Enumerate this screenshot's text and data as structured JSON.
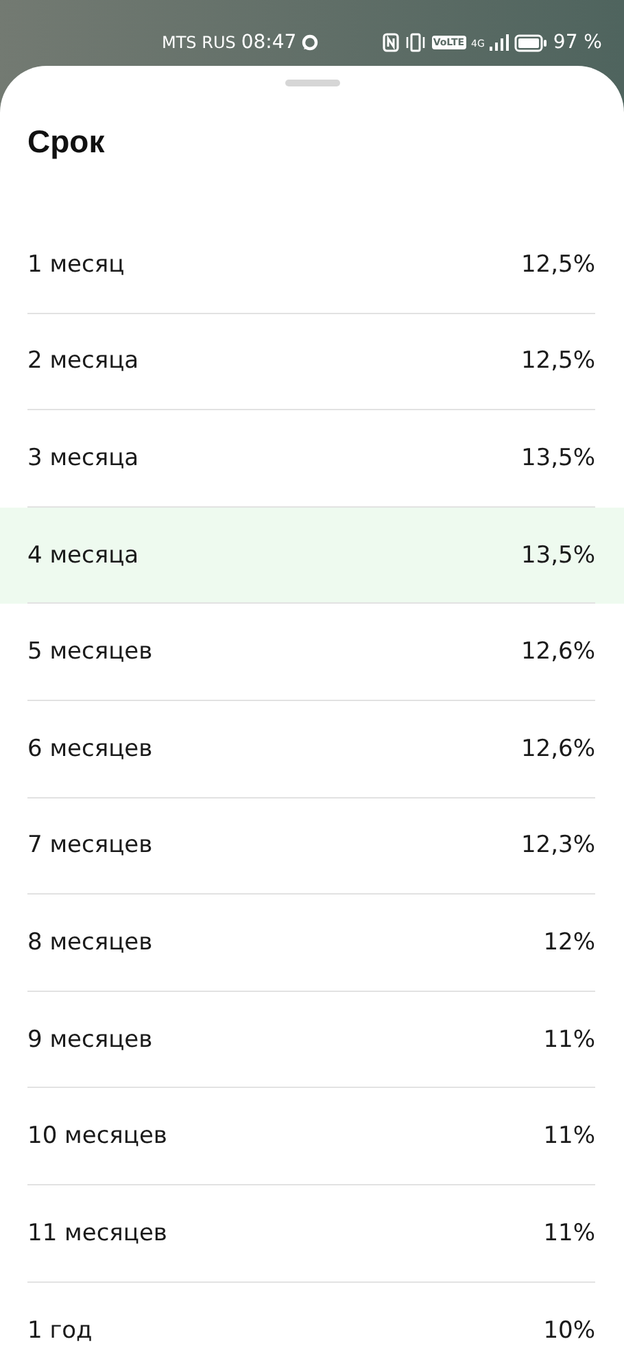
{
  "status_bar": {
    "carrier": "MTS RUS",
    "time": "08:47",
    "volte": "VoLTE",
    "network": "4G",
    "battery": "97 %"
  },
  "sheet": {
    "title": "Срок",
    "options": [
      {
        "label": "1 месяц",
        "rate": "12,5%",
        "selected": false
      },
      {
        "label": "2 месяца",
        "rate": "12,5%",
        "selected": false
      },
      {
        "label": "3 месяца",
        "rate": "13,5%",
        "selected": false
      },
      {
        "label": "4 месяца",
        "rate": "13,5%",
        "selected": true
      },
      {
        "label": "5 месяцев",
        "rate": "12,6%",
        "selected": false
      },
      {
        "label": "6 месяцев",
        "rate": "12,6%",
        "selected": false
      },
      {
        "label": "7 месяцев",
        "rate": "12,3%",
        "selected": false
      },
      {
        "label": "8 месяцев",
        "rate": "12%",
        "selected": false
      },
      {
        "label": "9 месяцев",
        "rate": "11%",
        "selected": false
      },
      {
        "label": "10 месяцев",
        "rate": "11%",
        "selected": false
      },
      {
        "label": "11 месяцев",
        "rate": "11%",
        "selected": false
      },
      {
        "label": "1 год",
        "rate": "10%",
        "selected": false
      }
    ]
  }
}
